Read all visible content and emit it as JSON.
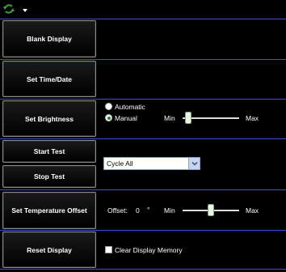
{
  "toolbar": {
    "refresh_icon": "refresh-icon",
    "menu_icon": "chevron-down-icon"
  },
  "buttons": {
    "blank_display": "Blank Display",
    "set_time_date": "Set Time/Date",
    "set_brightness": "Set Brightness",
    "start_test": "Start Test",
    "stop_test": "Stop Test",
    "set_temperature_offset": "Set Temperature Offset",
    "reset_display": "Reset Display"
  },
  "brightness": {
    "mode_options": [
      "Automatic",
      "Manual"
    ],
    "selected_mode": "Manual",
    "min_label": "Min",
    "max_label": "Max",
    "level": 0.05
  },
  "test": {
    "pattern_select_value": "Cycle All"
  },
  "temperature": {
    "offset_label": "Offset:",
    "offset_value": "0",
    "offset_unit": "°",
    "min_label": "Min",
    "max_label": "Max",
    "level": 0.5
  },
  "reset": {
    "clear_memory_label": "Clear Display Memory",
    "clear_memory_checked": false
  },
  "colors": {
    "separator": "#3b4fd6",
    "radio_selected": "#1c8a2a",
    "icon_green": "#3fa23a"
  }
}
